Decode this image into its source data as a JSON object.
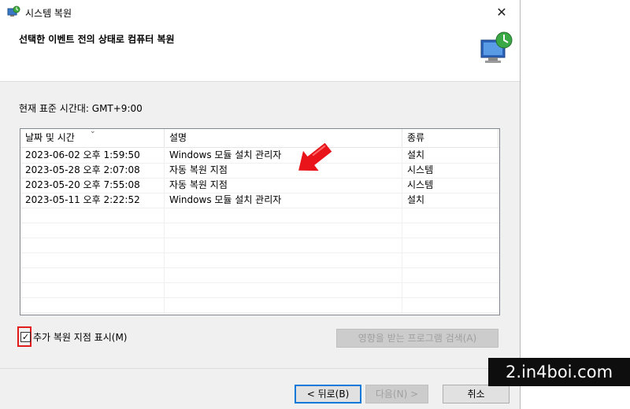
{
  "window": {
    "title": "시스템 복원"
  },
  "header": {
    "title": "선택한 이벤트 전의 상태로 컴퓨터 복원"
  },
  "timezone": "현재 표준 시간대: GMT+9:00",
  "table": {
    "columns": [
      "날짜 및 시간",
      "설명",
      "종류"
    ],
    "rows": [
      {
        "date": "2023-06-02 오후 1:59:50",
        "desc": "Windows 모듈 설치 관리자",
        "type": "설치"
      },
      {
        "date": "2023-05-28 오후 2:07:08",
        "desc": "자동 복원 지점",
        "type": "시스템"
      },
      {
        "date": "2023-05-20 오후 7:55:08",
        "desc": "자동 복원 지점",
        "type": "시스템"
      },
      {
        "date": "2023-05-11 오후 2:22:52",
        "desc": "Windows 모듈 설치 관리자",
        "type": "설치"
      }
    ]
  },
  "show_more": {
    "label": "추가 복원 지점 표시(M)",
    "checked": true
  },
  "scan_button": "영향을 받는 프로그램 검색(A)",
  "back_button": "< 뒤로(B)",
  "next_button": "다음(N) >",
  "cancel_button": "취소",
  "watermark": "2.in4boi.com",
  "colors": {
    "highlight": "#e21b1b",
    "accent": "#0078d7"
  },
  "icons": [
    "system-restore-icon",
    "close-icon",
    "monitor-restore-icon",
    "red-arrow-icon",
    "checkmark-icon",
    "sort-arrow-icon"
  ]
}
